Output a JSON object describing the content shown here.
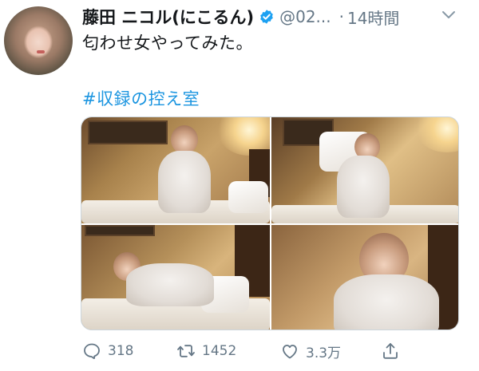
{
  "tweet": {
    "display_name": "藤田 ニコル(にこるん)",
    "handle": "@02...",
    "separator": "·",
    "time": "14時間",
    "text": "匂わせ女やってみた。",
    "hashtag": "#収録の控え室",
    "verified": true
  },
  "stats": {
    "replies": "318",
    "retweets": "1452",
    "likes": "3.3万"
  },
  "colors": {
    "link": "#1b95e0",
    "muted": "#657786",
    "verified_badge": "#1da1f2"
  },
  "icons": [
    "caret-down-icon",
    "verified-icon",
    "reply-icon",
    "retweet-icon",
    "like-icon",
    "share-icon"
  ]
}
